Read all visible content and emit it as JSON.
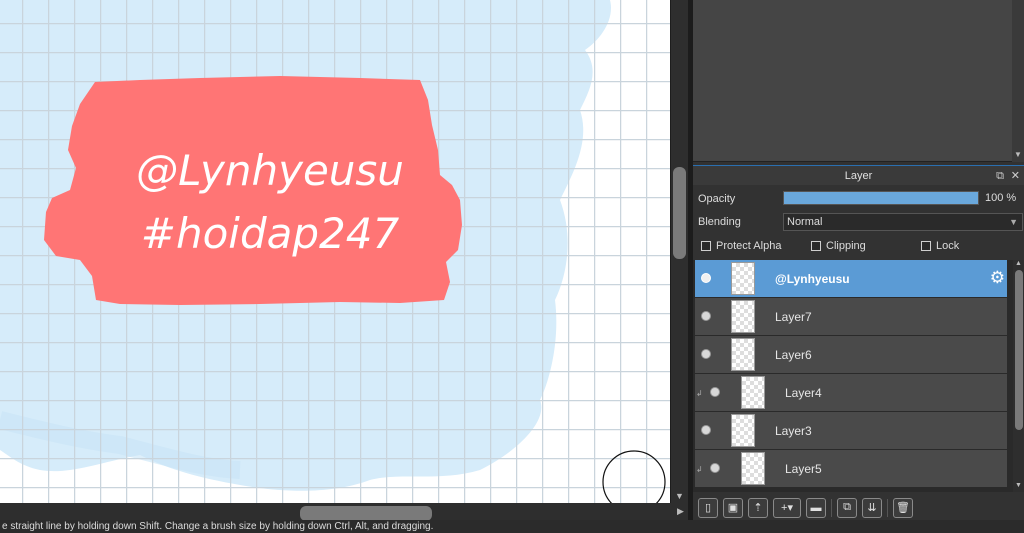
{
  "canvas": {
    "text_line1": "@Lynhyeusu",
    "text_line2": "#hoidap247"
  },
  "status": {
    "message": "e straight line by holding down Shift. Change a brush size by holding down Ctrl, Alt, and dragging."
  },
  "layer_panel": {
    "title": "Layer",
    "opacity_label": "Opacity",
    "opacity_value": "100 %",
    "opacity_fraction": 1.0,
    "blending_label": "Blending",
    "blending_value": "Normal",
    "protect_alpha_label": "Protect Alpha",
    "clipping_label": "Clipping",
    "lock_label": "Lock",
    "layers": [
      {
        "name": "@Lynhyeusu",
        "selected": true
      },
      {
        "name": "Layer7",
        "selected": false
      },
      {
        "name": "Layer6",
        "selected": false
      },
      {
        "name": "Layer4",
        "selected": false
      },
      {
        "name": "Layer3",
        "selected": false
      },
      {
        "name": "Layer5",
        "selected": false
      }
    ]
  },
  "colors": {
    "accent": "#5b9bd5",
    "sticker": "#ff7575",
    "sky": "#d6ecfa",
    "grid": "#c9d4dc"
  },
  "icons": [
    "new-layer-icon",
    "new-layer-from-icon",
    "import-image-icon",
    "add-layer-dropdown-icon",
    "folder-icon",
    "duplicate-layer-icon",
    "merge-layer-icon",
    "delete-layer-icon"
  ]
}
